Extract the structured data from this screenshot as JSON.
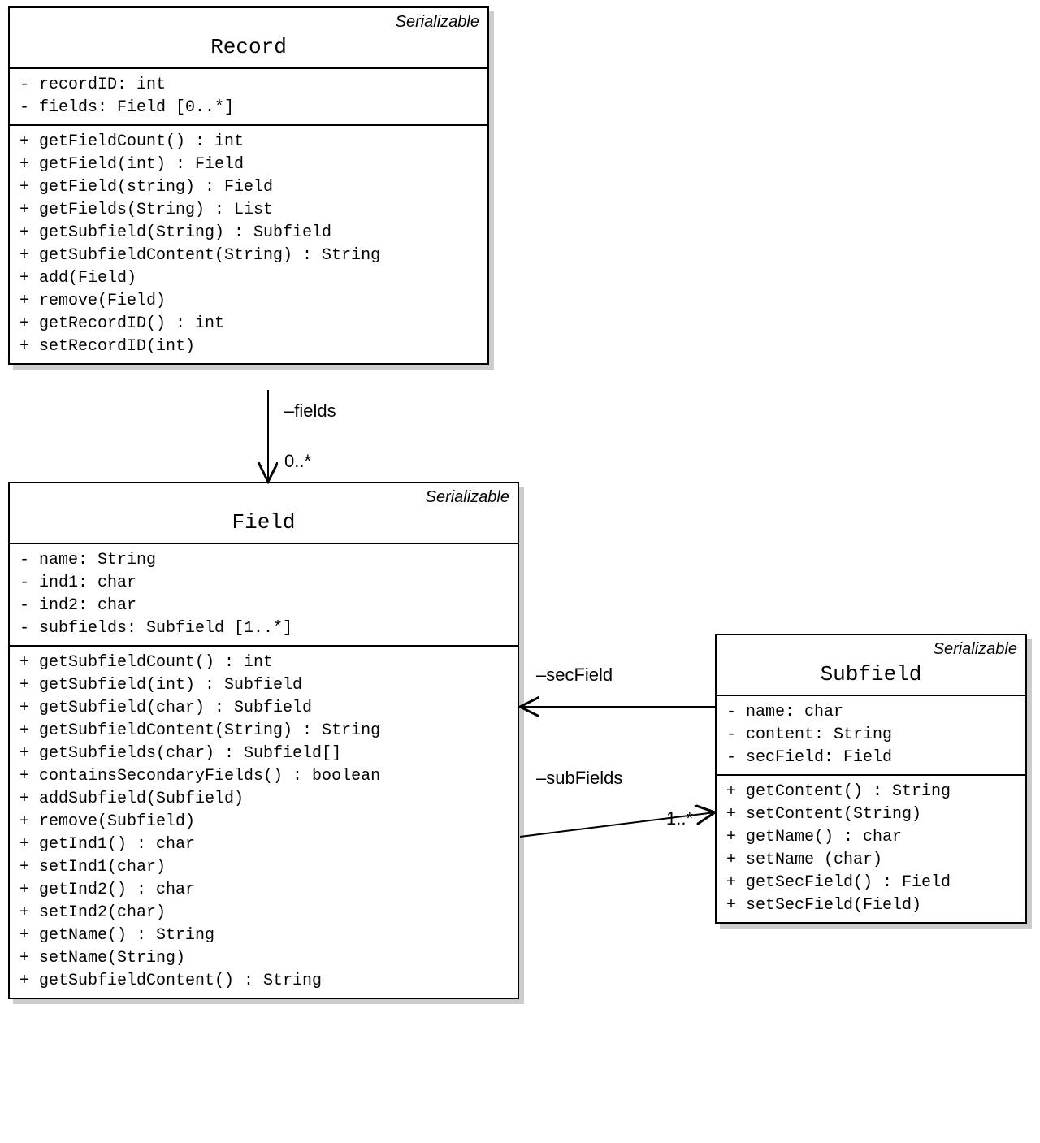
{
  "classes": {
    "record": {
      "stereotype": "Serializable",
      "name": "Record",
      "attributes": [
        "- recordID: int",
        "- fields: Field [0..*]"
      ],
      "operations": [
        "+ getFieldCount() : int",
        "+ getField(int) : Field",
        "+ getField(string) : Field",
        "+ getFields(String) : List",
        "+ getSubfield(String) : Subfield",
        "+ getSubfieldContent(String) : String",
        "+ add(Field)",
        "+ remove(Field)",
        "+ getRecordID() : int",
        "+ setRecordID(int)"
      ]
    },
    "field": {
      "stereotype": "Serializable",
      "name": "Field",
      "attributes": [
        "- name: String",
        "- ind1: char",
        "- ind2: char",
        "- subfields: Subfield [1..*]"
      ],
      "operations": [
        "+ getSubfieldCount() : int",
        "+ getSubfield(int) : Subfield",
        "+ getSubfield(char) : Subfield",
        "+ getSubfieldContent(String) : String",
        "+ getSubfields(char) : Subfield[]",
        "+ containsSecondaryFields() : boolean",
        "+ addSubfield(Subfield)",
        "+ remove(Subfield)",
        "+ getInd1() : char",
        "+ setInd1(char)",
        "+ getInd2() : char",
        "+ setInd2(char)",
        "+ getName() : String",
        "+ setName(String)",
        "+ getSubfieldContent() : String"
      ]
    },
    "subfield": {
      "stereotype": "Serializable",
      "name": "Subfield",
      "attributes": [
        "- name: char",
        "- content: String",
        "- secField: Field"
      ],
      "operations": [
        "+ getContent() : String",
        "+ setContent(String)",
        "+ getName() : char",
        "+ setName (char)",
        "+ getSecField() : Field",
        "+ setSecField(Field)"
      ]
    }
  },
  "associations": {
    "fields": {
      "label": "–fields",
      "mult": "0..*"
    },
    "secField": {
      "label": "–secField"
    },
    "subFields": {
      "label": "–subFields",
      "mult": "1..*"
    }
  },
  "chart_data": {
    "type": "uml-class-diagram",
    "classes": [
      {
        "name": "Record",
        "stereotype": "Serializable",
        "attributes": [
          {
            "vis": "-",
            "name": "recordID",
            "type": "int"
          },
          {
            "vis": "-",
            "name": "fields",
            "type": "Field",
            "multiplicity": "0..*"
          }
        ],
        "operations": [
          {
            "vis": "+",
            "sig": "getFieldCount()",
            "ret": "int"
          },
          {
            "vis": "+",
            "sig": "getField(int)",
            "ret": "Field"
          },
          {
            "vis": "+",
            "sig": "getField(string)",
            "ret": "Field"
          },
          {
            "vis": "+",
            "sig": "getFields(String)",
            "ret": "List"
          },
          {
            "vis": "+",
            "sig": "getSubfield(String)",
            "ret": "Subfield"
          },
          {
            "vis": "+",
            "sig": "getSubfieldContent(String)",
            "ret": "String"
          },
          {
            "vis": "+",
            "sig": "add(Field)"
          },
          {
            "vis": "+",
            "sig": "remove(Field)"
          },
          {
            "vis": "+",
            "sig": "getRecordID()",
            "ret": "int"
          },
          {
            "vis": "+",
            "sig": "setRecordID(int)"
          }
        ]
      },
      {
        "name": "Field",
        "stereotype": "Serializable",
        "attributes": [
          {
            "vis": "-",
            "name": "name",
            "type": "String"
          },
          {
            "vis": "-",
            "name": "ind1",
            "type": "char"
          },
          {
            "vis": "-",
            "name": "ind2",
            "type": "char"
          },
          {
            "vis": "-",
            "name": "subfields",
            "type": "Subfield",
            "multiplicity": "1..*"
          }
        ],
        "operations": [
          {
            "vis": "+",
            "sig": "getSubfieldCount()",
            "ret": "int"
          },
          {
            "vis": "+",
            "sig": "getSubfield(int)",
            "ret": "Subfield"
          },
          {
            "vis": "+",
            "sig": "getSubfield(char)",
            "ret": "Subfield"
          },
          {
            "vis": "+",
            "sig": "getSubfieldContent(String)",
            "ret": "String"
          },
          {
            "vis": "+",
            "sig": "getSubfields(char)",
            "ret": "Subfield[]"
          },
          {
            "vis": "+",
            "sig": "containsSecondaryFields()",
            "ret": "boolean"
          },
          {
            "vis": "+",
            "sig": "addSubfield(Subfield)"
          },
          {
            "vis": "+",
            "sig": "remove(Subfield)"
          },
          {
            "vis": "+",
            "sig": "getInd1()",
            "ret": "char"
          },
          {
            "vis": "+",
            "sig": "setInd1(char)"
          },
          {
            "vis": "+",
            "sig": "getInd2()",
            "ret": "char"
          },
          {
            "vis": "+",
            "sig": "setInd2(char)"
          },
          {
            "vis": "+",
            "sig": "getName()",
            "ret": "String"
          },
          {
            "vis": "+",
            "sig": "setName(String)"
          },
          {
            "vis": "+",
            "sig": "getSubfieldContent()",
            "ret": "String"
          }
        ]
      },
      {
        "name": "Subfield",
        "stereotype": "Serializable",
        "attributes": [
          {
            "vis": "-",
            "name": "name",
            "type": "char"
          },
          {
            "vis": "-",
            "name": "content",
            "type": "String"
          },
          {
            "vis": "-",
            "name": "secField",
            "type": "Field"
          }
        ],
        "operations": [
          {
            "vis": "+",
            "sig": "getContent()",
            "ret": "String"
          },
          {
            "vis": "+",
            "sig": "setContent(String)"
          },
          {
            "vis": "+",
            "sig": "getName()",
            "ret": "char"
          },
          {
            "vis": "+",
            "sig": "setName (char)"
          },
          {
            "vis": "+",
            "sig": "getSecField()",
            "ret": "Field"
          },
          {
            "vis": "+",
            "sig": "setSecField(Field)"
          }
        ]
      }
    ],
    "associations": [
      {
        "from": "Record",
        "to": "Field",
        "role": "fields",
        "multiplicity": "0..*",
        "navigable": true
      },
      {
        "from": "Subfield",
        "to": "Field",
        "role": "secField",
        "navigable": true
      },
      {
        "from": "Field",
        "to": "Subfield",
        "role": "subFields",
        "multiplicity": "1..*",
        "navigable": true
      }
    ]
  }
}
